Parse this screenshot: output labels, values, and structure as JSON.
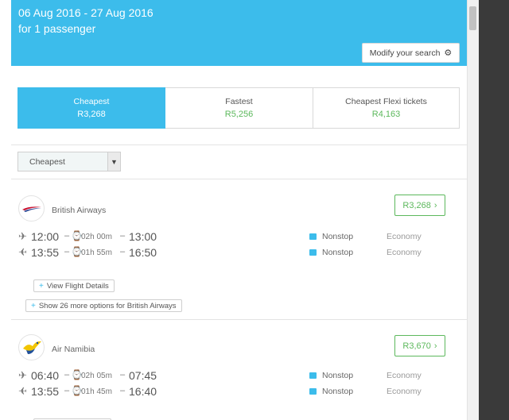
{
  "header": {
    "dates": "06 Aug 2016 - 27 Aug 2016",
    "passengers": "for 1 passenger",
    "modify_label": "Modify your search",
    "modify_icon": "gear-icon"
  },
  "tabs": [
    {
      "label": "Cheapest",
      "price": "R3,268",
      "active": true
    },
    {
      "label": "Fastest",
      "price": "R5,256",
      "active": false
    },
    {
      "label": "Cheapest Flexi tickets",
      "price": "R4,163",
      "active": false
    }
  ],
  "sort": {
    "selected": "Cheapest"
  },
  "flights": [
    {
      "airline": "British Airways",
      "price": "R3,268",
      "legs": [
        {
          "dep": "12:00",
          "duration": "02h 00m",
          "arr": "13:00",
          "stops": "Nonstop",
          "cabin": "Economy",
          "direction": "outbound"
        },
        {
          "dep": "13:55",
          "duration": "01h 55m",
          "arr": "16:50",
          "stops": "Nonstop",
          "cabin": "Economy",
          "direction": "return"
        }
      ],
      "details_label": "View Flight Details",
      "more_label": "Show 26 more options for British Airways"
    },
    {
      "airline": "Air Namibia",
      "price": "R3,670",
      "legs": [
        {
          "dep": "06:40",
          "duration": "02h 05m",
          "arr": "07:45",
          "stops": "Nonstop",
          "cabin": "Economy",
          "direction": "outbound"
        },
        {
          "dep": "13:55",
          "duration": "01h 45m",
          "arr": "16:40",
          "stops": "Nonstop",
          "cabin": "Economy",
          "direction": "return"
        }
      ]
    }
  ],
  "colors": {
    "accent": "#3cbceb",
    "price": "#5cb85c"
  }
}
